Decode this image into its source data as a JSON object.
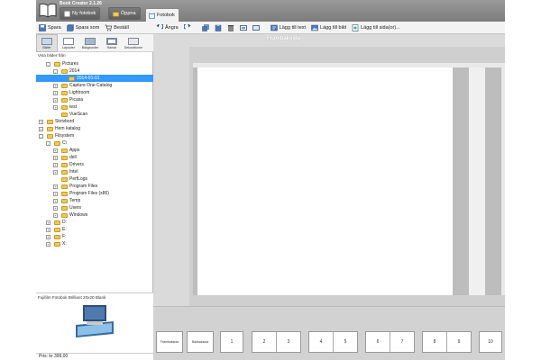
{
  "app": {
    "title": "Book Creator 2.1.26",
    "new_photobook_label": "Ny fotobok",
    "open_label": "Öppna",
    "tab_label": "Fotobok"
  },
  "left_toolbar": [
    {
      "name": "save-button",
      "label": "Spara",
      "icon": "disk-icon"
    },
    {
      "name": "save-as-button",
      "label": "Spara som",
      "icon": "disk-stack-icon"
    },
    {
      "name": "order-button",
      "label": "Beställ",
      "icon": "cart-icon"
    }
  ],
  "main_toolbar": {
    "undo_label": "Ångra",
    "add_text_label": "Lägg till text",
    "add_image_label": "Lägg till bild",
    "add_page_label": "Lägg till sida(or)..."
  },
  "categories": [
    {
      "label": "Bilder",
      "active": true
    },
    {
      "label": "Layouter",
      "active": false
    },
    {
      "label": "Bakgrunder",
      "active": false
    },
    {
      "label": "Ramar",
      "active": false
    },
    {
      "label": "Dekorationer",
      "active": false
    }
  ],
  "show_images_from": "Visa bilder från",
  "tree": [
    {
      "label": "Pictures",
      "level": 1,
      "expander": "-"
    },
    {
      "label": "2014",
      "level": 2,
      "expander": "-"
    },
    {
      "label": "2014-01-01",
      "level": 3,
      "expander": "",
      "selected": true
    },
    {
      "label": "Capture One Catalog",
      "level": 2,
      "expander": "+"
    },
    {
      "label": "Lightroom",
      "level": 2,
      "expander": "+"
    },
    {
      "label": "Picasa",
      "level": 2,
      "expander": "+"
    },
    {
      "label": "test",
      "level": 2,
      "expander": "+"
    },
    {
      "label": "VueScan",
      "level": 2,
      "expander": ""
    },
    {
      "label": "Skrivbord",
      "level": 0,
      "expander": "+"
    },
    {
      "label": "Hem katalog",
      "level": 0,
      "expander": "+"
    },
    {
      "label": "Filsystem",
      "level": 0,
      "expander": "-"
    },
    {
      "label": "C\\",
      "level": 1,
      "expander": "-"
    },
    {
      "label": "Apps",
      "level": 2,
      "expander": "+"
    },
    {
      "label": "dell",
      "level": 2,
      "expander": "+"
    },
    {
      "label": "Drivers",
      "level": 2,
      "expander": "+"
    },
    {
      "label": "Intel",
      "level": 2,
      "expander": "+"
    },
    {
      "label": "PerfLogs",
      "level": 2,
      "expander": ""
    },
    {
      "label": "Program Files",
      "level": 2,
      "expander": "+"
    },
    {
      "label": "Program Files (x86)",
      "level": 2,
      "expander": "+"
    },
    {
      "label": "Temp",
      "level": 2,
      "expander": "+"
    },
    {
      "label": "Users",
      "level": 2,
      "expander": "+"
    },
    {
      "label": "Windows",
      "level": 2,
      "expander": "+"
    },
    {
      "label": "D:",
      "level": 1,
      "expander": "+"
    },
    {
      "label": "E:",
      "level": 1,
      "expander": "+"
    },
    {
      "label": "F:",
      "level": 1,
      "expander": "+"
    },
    {
      "label": "X:",
      "level": 1,
      "expander": "+"
    }
  ],
  "preview_caption": "Fujifilm Fotobok Brilliant 20x20 Blank",
  "price": "Pris: kr 399,00",
  "page_label": "Främbaksida",
  "thumbnails": [
    {
      "name": "thumb-cover-front",
      "labels": [
        "Främbaksida"
      ]
    },
    {
      "name": "thumb-cover-back",
      "labels": [
        "Bakbaksida"
      ]
    },
    {
      "name": "thumb-page-1",
      "labels": [
        "1"
      ]
    },
    {
      "name": "thumb-spread-2-3",
      "labels": [
        "2",
        "3"
      ]
    },
    {
      "name": "thumb-spread-4-5",
      "labels": [
        "4",
        "5"
      ]
    },
    {
      "name": "thumb-spread-6-7",
      "labels": [
        "6",
        "7"
      ]
    },
    {
      "name": "thumb-spread-8-9",
      "labels": [
        "8",
        "9"
      ]
    },
    {
      "name": "thumb-page-10",
      "labels": [
        "10"
      ]
    }
  ]
}
